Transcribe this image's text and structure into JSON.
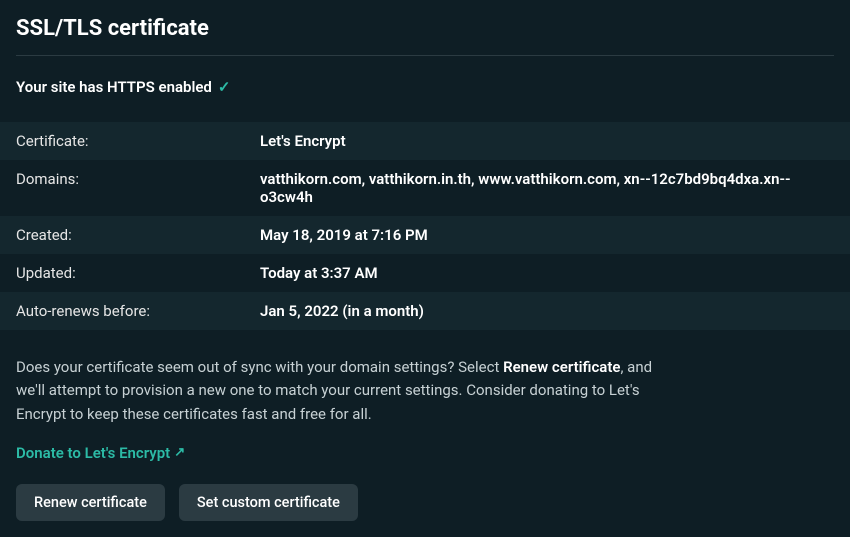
{
  "page": {
    "title": "SSL/TLS certificate"
  },
  "status": {
    "text": "Your site has HTTPS enabled"
  },
  "cert": {
    "rows": [
      {
        "label": "Certificate:",
        "value": "Let's Encrypt"
      },
      {
        "label": "Domains:",
        "value": "vatthikorn.com, vatthikorn.in.th, www.vatthikorn.com, xn--12c7bd9bq4dxa.xn--o3cw4h"
      },
      {
        "label": "Created:",
        "value": "May 18, 2019 at 7:16 PM"
      },
      {
        "label": "Updated:",
        "value": "Today at 3:37 AM"
      },
      {
        "label": "Auto-renews before:",
        "value": "Jan 5, 2022 (in a month)"
      }
    ]
  },
  "help": {
    "pre": "Does your certificate seem out of sync with your domain settings? Select ",
    "bold": "Renew certificate",
    "post": ", and we'll attempt to provision a new one to match your current settings. Consider donating to Let's Encrypt to keep these certificates fast and free for all."
  },
  "links": {
    "donate": "Donate to Let's Encrypt"
  },
  "buttons": {
    "renew": "Renew certificate",
    "custom": "Set custom certificate"
  }
}
